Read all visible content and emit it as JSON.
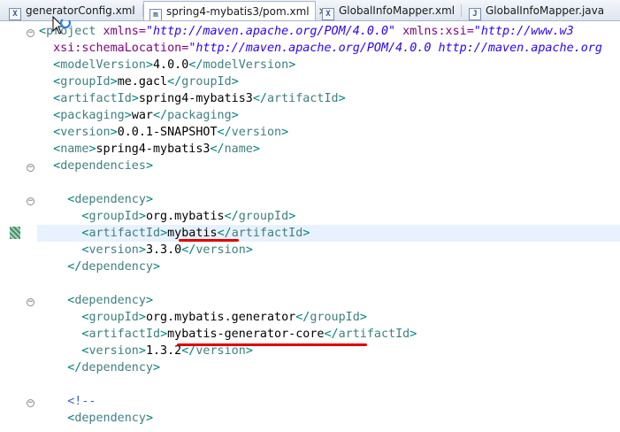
{
  "tabs": [
    {
      "label": "generatorConfig.xml",
      "icon": "xml-file-icon",
      "active": false
    },
    {
      "label": "spring4-mybatis3/pom.xml",
      "icon": "maven-pom-file-icon",
      "active": true,
      "close": "✕"
    },
    {
      "label": "GlobalInfoMapper.xml",
      "icon": "xml-file-icon",
      "active": false
    },
    {
      "label": "GlobalInfoMapper.java",
      "icon": "java-file-icon",
      "active": false
    }
  ],
  "editor": {
    "lines": {
      "l01": {
        "b1": "<",
        "tag": "project",
        "attr1": " xmlns=",
        "val1": "\"http://maven.apache.org/POM/4.0.0\"",
        "attr2": " xmlns:xsi=",
        "val2": "\"http://www.w3"
      },
      "l02": {
        "attr": "xsi:schemaLocation=",
        "val": "\"http://maven.apache.org/POM/4.0.0 http://maven.apache.org"
      },
      "l03": {
        "open": "<",
        "tag": "modelVersion",
        "close": ">",
        "text": "4.0.0",
        "eopen": "</",
        "etag": "modelVersion",
        "eclose": ">"
      },
      "l04": {
        "open": "<",
        "tag": "groupId",
        "close": ">",
        "text": "me.gacl",
        "eopen": "</",
        "etag": "groupId",
        "eclose": ">"
      },
      "l05": {
        "open": "<",
        "tag": "artifactId",
        "close": ">",
        "text": "spring4-mybatis3",
        "eopen": "</",
        "etag": "artifactId",
        "eclose": ">"
      },
      "l06": {
        "open": "<",
        "tag": "packaging",
        "close": ">",
        "text": "war",
        "eopen": "</",
        "etag": "packaging",
        "eclose": ">"
      },
      "l07": {
        "open": "<",
        "tag": "version",
        "close": ">",
        "text": "0.0.1-SNAPSHOT",
        "eopen": "</",
        "etag": "version",
        "eclose": ">"
      },
      "l08": {
        "open": "<",
        "tag": "name",
        "close": ">",
        "text": "spring4-mybatis3",
        "eopen": "</",
        "etag": "name",
        "eclose": ">"
      },
      "l09": {
        "open": "<",
        "tag": "dependencies",
        "close": ">"
      },
      "l11": {
        "open": "<",
        "tag": "dependency",
        "close": ">"
      },
      "l12": {
        "open": "<",
        "tag": "groupId",
        "close": ">",
        "text": "org.mybatis",
        "eopen": "</",
        "etag": "groupId",
        "eclose": ">"
      },
      "l13": {
        "open": "<",
        "tag": "artifactId",
        "close": ">",
        "text": "mybatis",
        "eopen": "</",
        "etag": "artifactId",
        "eclose": ">"
      },
      "l14": {
        "open": "<",
        "tag": "version",
        "close": ">",
        "text": "3.3.0",
        "eopen": "</",
        "etag": "version",
        "eclose": ">"
      },
      "l15": {
        "open": "</",
        "tag": "dependency",
        "close": ">"
      },
      "l17": {
        "open": "<",
        "tag": "dependency",
        "close": ">"
      },
      "l18": {
        "open": "<",
        "tag": "groupId",
        "close": ">",
        "text": "org.mybatis.generator",
        "eopen": "</",
        "etag": "groupId",
        "eclose": ">"
      },
      "l19": {
        "open": "<",
        "tag": "artifactId",
        "close": ">",
        "text": "mybatis-generator-core",
        "eopen": "</",
        "etag": "artifactId",
        "eclose": ">"
      },
      "l20": {
        "open": "<",
        "tag": "version",
        "close": ">",
        "text": "1.3.2",
        "eopen": "</",
        "etag": "version",
        "eclose": ">"
      },
      "l21": {
        "open": "</",
        "tag": "dependency",
        "close": ">"
      },
      "l23": {
        "comment": "<!--"
      },
      "l24": {
        "open": "<",
        "tag": "dependency",
        "close": ">"
      }
    },
    "fold_glyph": "−",
    "highlighted_line": 13,
    "annotation_color": "#e00000"
  }
}
